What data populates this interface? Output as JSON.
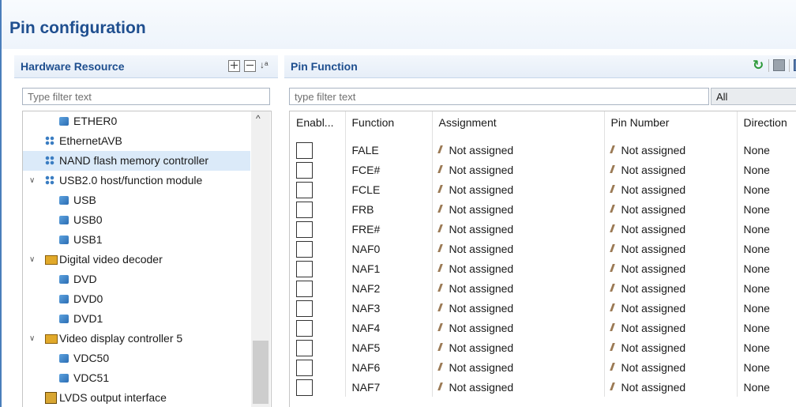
{
  "title": "Pin configuration",
  "hardware_panel": {
    "title": "Hardware Resource",
    "filter_placeholder": "Type filter text",
    "tree": [
      {
        "label": "ETHER0",
        "icon": "chip-icon",
        "level": 2
      },
      {
        "label": "EthernetAVB",
        "icon": "module-icon",
        "level": 1
      },
      {
        "label": "NAND flash memory controller",
        "icon": "module-icon",
        "level": 1,
        "selected": true
      },
      {
        "label": "USB2.0 host/function module",
        "icon": "module-icon",
        "level": 1,
        "expanded": true
      },
      {
        "label": "USB",
        "icon": "chip-icon",
        "level": 2
      },
      {
        "label": "USB0",
        "icon": "chip-icon",
        "level": 2
      },
      {
        "label": "USB1",
        "icon": "chip-icon",
        "level": 2
      },
      {
        "label": "Digital video decoder",
        "icon": "video-icon",
        "level": 1,
        "expanded": true
      },
      {
        "label": "DVD",
        "icon": "chip-icon",
        "level": 2
      },
      {
        "label": "DVD0",
        "icon": "chip-icon",
        "level": 2
      },
      {
        "label": "DVD1",
        "icon": "chip-icon",
        "level": 2
      },
      {
        "label": "Video display controller 5",
        "icon": "video-icon",
        "level": 1,
        "expanded": true
      },
      {
        "label": "VDC50",
        "icon": "chip-icon",
        "level": 2
      },
      {
        "label": "VDC51",
        "icon": "chip-icon",
        "level": 2
      },
      {
        "label": "LVDS output interface",
        "icon": "lvds-icon",
        "level": 1
      }
    ]
  },
  "pin_panel": {
    "title": "Pin Function",
    "filter_placeholder": "type filter text",
    "scope_value": "All",
    "columns": [
      "Enabl...",
      "Function",
      "Assignment",
      "Pin Number",
      "Direction"
    ],
    "rows": [
      {
        "enabled": false,
        "function": "FALE",
        "assignment": "Not assigned",
        "pin_number": "Not assigned",
        "direction": "None"
      },
      {
        "enabled": false,
        "function": "FCE#",
        "assignment": "Not assigned",
        "pin_number": "Not assigned",
        "direction": "None"
      },
      {
        "enabled": false,
        "function": "FCLE",
        "assignment": "Not assigned",
        "pin_number": "Not assigned",
        "direction": "None"
      },
      {
        "enabled": false,
        "function": "FRB",
        "assignment": "Not assigned",
        "pin_number": "Not assigned",
        "direction": "None"
      },
      {
        "enabled": false,
        "function": "FRE#",
        "assignment": "Not assigned",
        "pin_number": "Not assigned",
        "direction": "None"
      },
      {
        "enabled": false,
        "function": "NAF0",
        "assignment": "Not assigned",
        "pin_number": "Not assigned",
        "direction": "None"
      },
      {
        "enabled": false,
        "function": "NAF1",
        "assignment": "Not assigned",
        "pin_number": "Not assigned",
        "direction": "None"
      },
      {
        "enabled": false,
        "function": "NAF2",
        "assignment": "Not assigned",
        "pin_number": "Not assigned",
        "direction": "None"
      },
      {
        "enabled": false,
        "function": "NAF3",
        "assignment": "Not assigned",
        "pin_number": "Not assigned",
        "direction": "None"
      },
      {
        "enabled": false,
        "function": "NAF4",
        "assignment": "Not assigned",
        "pin_number": "Not assigned",
        "direction": "None"
      },
      {
        "enabled": false,
        "function": "NAF5",
        "assignment": "Not assigned",
        "pin_number": "Not assigned",
        "direction": "None"
      },
      {
        "enabled": false,
        "function": "NAF6",
        "assignment": "Not assigned",
        "pin_number": "Not assigned",
        "direction": "None"
      },
      {
        "enabled": false,
        "function": "NAF7",
        "assignment": "Not assigned",
        "pin_number": "Not assigned",
        "direction": "None"
      }
    ]
  }
}
